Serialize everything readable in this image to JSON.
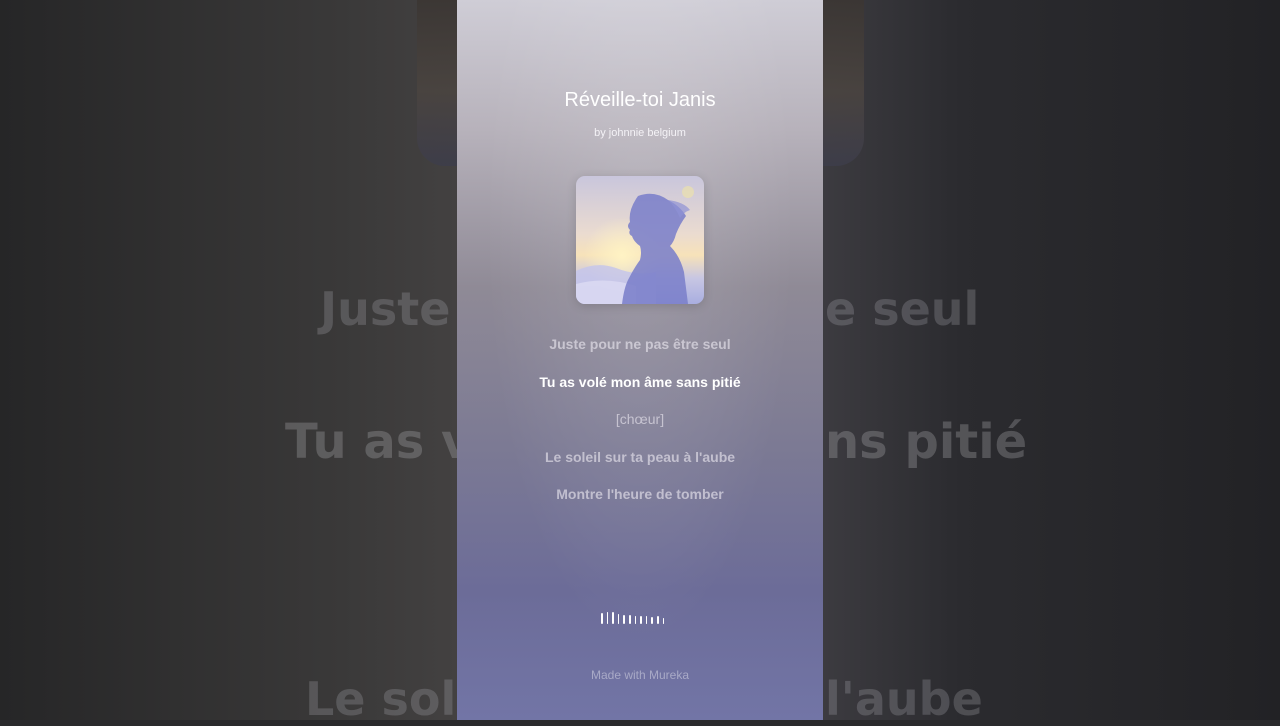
{
  "song": {
    "title": "Réveille-toi Janis",
    "artist": "by johnnie belgium"
  },
  "lyrics": {
    "lines": [
      "Juste pour ne pas être seul",
      "Tu as volé mon âme sans pitié",
      "[chœur]",
      "Le soleil sur ta peau à l'aube",
      "Montre l'heure de tomber"
    ],
    "active_index": 1
  },
  "background": {
    "line1_left": "Juste",
    "line1_right": "e seul",
    "line2_left": "Tu as vo",
    "line2_right": "ns pitié",
    "line3_left": "Le solei",
    "line3_right": "l'aube"
  },
  "footer": {
    "credit": "Made with Mureka"
  },
  "colors": {
    "active_lyric": "#ffffff",
    "inactive_lyric": "#ebe8f0",
    "panel_bottom": "#7275a6"
  }
}
